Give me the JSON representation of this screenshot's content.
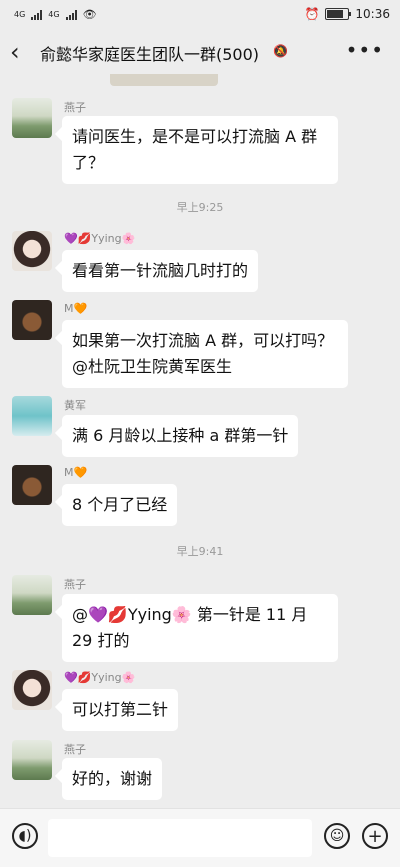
{
  "status": {
    "net1": "4G",
    "net2": "4G",
    "time": "10:36"
  },
  "header": {
    "title": "俞懿华家庭医生团队一群(500)",
    "more": "•••"
  },
  "messages": [
    {
      "sender": "燕子",
      "text": "请问医生，是不是可以打流脑 A 群了？"
    },
    {
      "time": "早上9:25"
    },
    {
      "sender": "💜💋Yying🌸",
      "text": "看看第一针流脑几时打的"
    },
    {
      "sender": "M🧡",
      "text": "如果第一次打流脑 A 群，可以打吗？@杜阮卫生院黄军医生"
    },
    {
      "sender": "黄军",
      "text": "满 6 月龄以上接种 a 群第一针"
    },
    {
      "sender": "M🧡",
      "text": "8 个月了已经"
    },
    {
      "time": "早上9:41"
    },
    {
      "sender": "燕子",
      "text": "@💜💋Yying🌸  第一针是 11 月 29 打的"
    },
    {
      "sender": "💜💋Yying🌸",
      "text": "可以打第二针"
    },
    {
      "sender": "燕子",
      "text": "好的，谢谢"
    }
  ],
  "icons": [
    "back-arrow-icon",
    "mute-bell-icon",
    "more-icon",
    "voice-icon",
    "emoji-icon",
    "plus-icon"
  ]
}
